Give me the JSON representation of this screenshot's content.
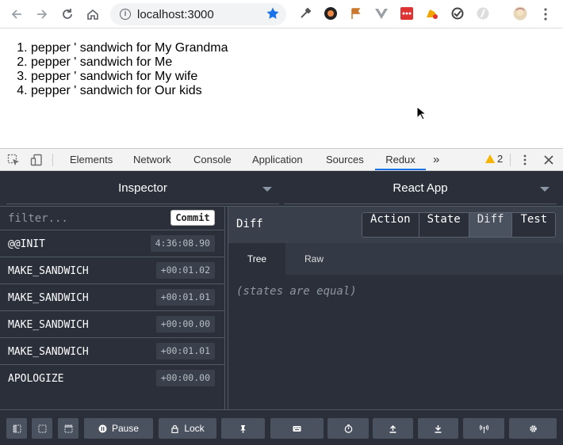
{
  "browser": {
    "url": "localhost:3000"
  },
  "page": {
    "items": [
      "pepper ' sandwich for My Grandma",
      "pepper ' sandwich for Me",
      "pepper ' sandwich for My wife",
      "pepper ' sandwich for Our kids"
    ]
  },
  "devtools": {
    "tabs": [
      "Elements",
      "Network",
      "Console",
      "Application",
      "Sources",
      "Redux"
    ],
    "active_tab": "Redux",
    "more": "»",
    "warning_count": "2"
  },
  "redux": {
    "inspector_label": "Inspector",
    "instance_label": "React App",
    "filter_placeholder": "filter...",
    "commit_label": "Commit",
    "actions": [
      {
        "name": "@@INIT",
        "time": "4:36:08.90"
      },
      {
        "name": "MAKE_SANDWICH",
        "time": "+00:01.02"
      },
      {
        "name": "MAKE_SANDWICH",
        "time": "+00:01.01"
      },
      {
        "name": "MAKE_SANDWICH",
        "time": "+00:00.00"
      },
      {
        "name": "MAKE_SANDWICH",
        "time": "+00:01.01"
      },
      {
        "name": "APOLOGIZE",
        "time": "+00:00.00"
      }
    ],
    "panel_title": "Diff",
    "monitor_tabs": [
      "Action",
      "State",
      "Diff",
      "Test"
    ],
    "active_monitor_tab": "Diff",
    "sub_tabs": [
      "Tree",
      "Raw"
    ],
    "active_sub_tab": "Tree",
    "diff_message": "(states are equal)",
    "pause_label": "Pause",
    "lock_label": "Lock"
  },
  "colors": {
    "panel_bg": "#2a2f3a",
    "accent_blue": "#1a73e8",
    "warning": "#f4b400"
  }
}
